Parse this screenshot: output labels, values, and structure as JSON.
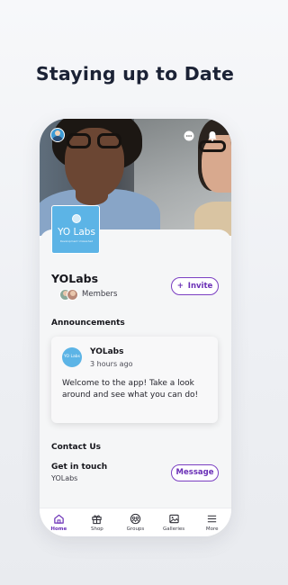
{
  "headline": "Staying up to Date",
  "group": {
    "logo_name": "YO Labs",
    "logo_tagline": "Development Unleashed",
    "title": "YOLabs",
    "members_label": "Members",
    "invite_label": "Invite"
  },
  "announcements": {
    "section_title": "Announcements",
    "post": {
      "logo_text": "YO Labs",
      "author": "YOLabs",
      "time": "3 hours ago",
      "body": "Welcome to the app! Take a look around and see what you can do!"
    }
  },
  "contact": {
    "section_title": "Contact Us",
    "title": "Get in touch",
    "subtitle": "YOLabs",
    "message_label": "Message"
  },
  "nav": {
    "items": [
      {
        "label": "Home",
        "icon": "home-icon",
        "active": true
      },
      {
        "label": "Shop",
        "icon": "gift-icon",
        "active": false
      },
      {
        "label": "Groups",
        "icon": "groups-icon",
        "active": false
      },
      {
        "label": "Galleries",
        "icon": "image-icon",
        "active": false
      },
      {
        "label": "More",
        "icon": "menu-icon",
        "active": false
      }
    ]
  },
  "colors": {
    "accent": "#6a2fb6",
    "brand_blue": "#5cb4e6",
    "headline": "#1b2235"
  }
}
